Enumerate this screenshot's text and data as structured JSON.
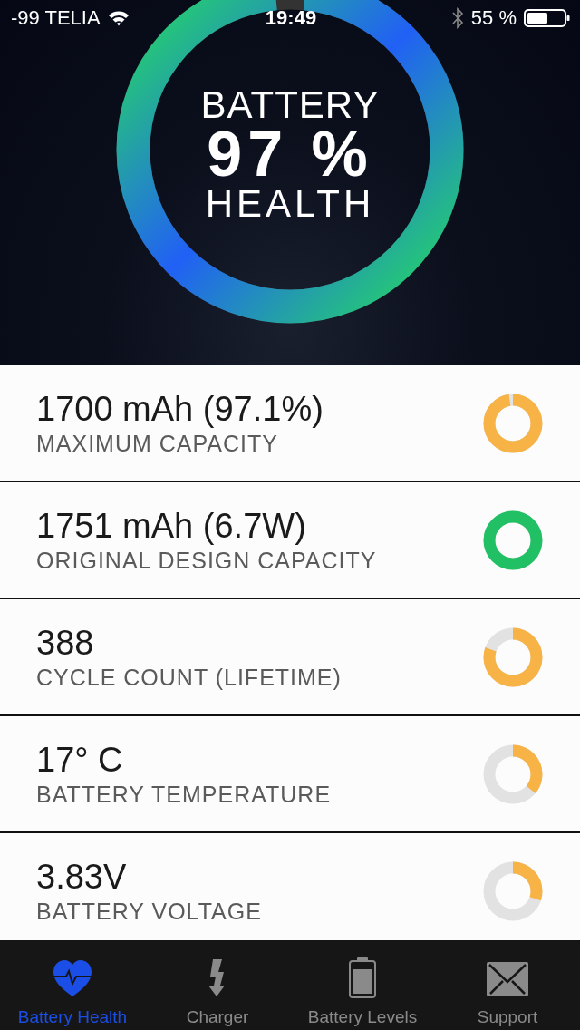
{
  "status_bar": {
    "carrier": "-99 TELIA",
    "time": "19:49",
    "battery": "55 %"
  },
  "health": {
    "title": "BATTERY",
    "value": "97 %",
    "subtitle": "HEALTH"
  },
  "stats": [
    {
      "value": "1700 mAh (97.1%)",
      "label": "MAXIMUM CAPACITY",
      "level": 0.971,
      "color": "#f7b345"
    },
    {
      "value": "1751 mAh (6.7W)",
      "label": "ORIGINAL DESIGN CAPACITY",
      "level": 1,
      "color": "#22c064"
    },
    {
      "value": "388",
      "label": "CYCLE COUNT (LIFETIME)",
      "level": 0.8,
      "color": "#f7b345"
    },
    {
      "value": "17° C",
      "label": "BATTERY TEMPERATURE",
      "level": 0.36,
      "color": "#f7b345"
    },
    {
      "value": "3.83V",
      "label": "BATTERY VOLTAGE",
      "level": 0.3,
      "color": "#f7b345"
    }
  ],
  "tabs": [
    {
      "label": "Battery Health",
      "kind": "heart",
      "selected": true
    },
    {
      "label": "Charger",
      "kind": "bolt",
      "selected": false
    },
    {
      "label": "Battery Levels",
      "kind": "battery",
      "selected": false
    },
    {
      "label": "Support",
      "kind": "mail",
      "selected": false
    }
  ]
}
